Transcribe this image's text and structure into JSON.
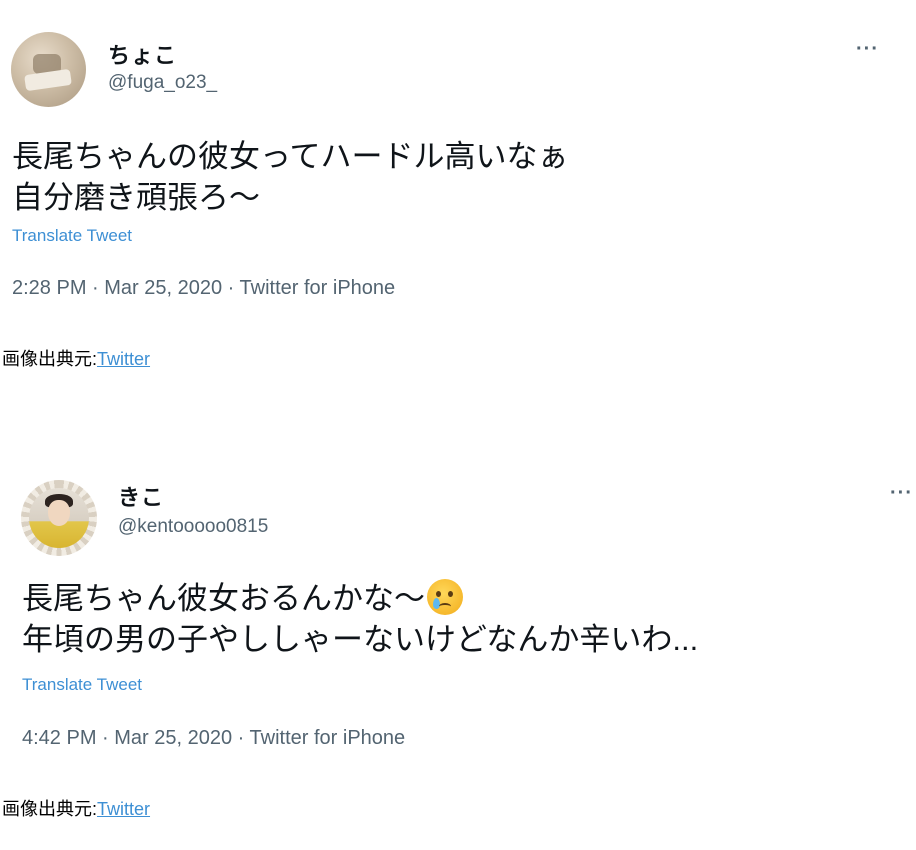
{
  "tweets": [
    {
      "display_name": "ちょこ",
      "handle": "@fuga_o23_",
      "more": "···",
      "body_line1": "長尾ちゃんの彼女ってハードル高いなぁ",
      "body_line2": "自分磨き頑張ろ〜",
      "translate": "Translate Tweet",
      "meta": "2:28 PM · Mar 25, 2020 · Twitter for iPhone"
    },
    {
      "display_name": "きこ",
      "handle": "@kentooooo0815",
      "more": "···",
      "body_line1": "長尾ちゃん彼女おるんかな〜",
      "emoji": "crying-face",
      "body_line2": "年頃の男の子やししゃーないけどなんか辛いわ...",
      "translate": "Translate Tweet",
      "meta": "4:42 PM · Mar 25, 2020 · Twitter for iPhone"
    }
  ],
  "sources": [
    {
      "label": "画像出典元:",
      "link": "Twitter"
    },
    {
      "label": "画像出典元:",
      "link": "Twitter"
    }
  ],
  "colors": {
    "link": "#3d8fd4",
    "secondary_text": "#536471",
    "primary_text": "#0f1419"
  }
}
